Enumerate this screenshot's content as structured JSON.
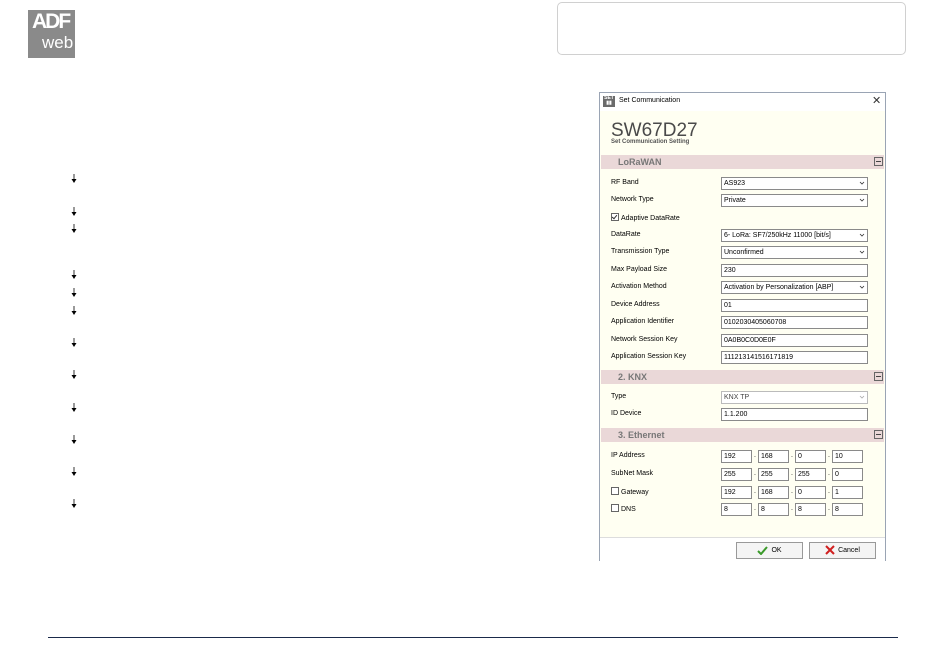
{
  "logo": {
    "line1": "ADF",
    "line2": "web"
  },
  "dialog": {
    "title": "Set Communication",
    "big_title": "SW67D27",
    "subtitle": "Set Communication Setting",
    "sections": {
      "lorawan": "LoRaWAN",
      "knx": "2. KNX",
      "ethernet": "3. Ethernet"
    },
    "lorawan": {
      "rf_band": {
        "label": "RF Band",
        "value": "AS923"
      },
      "network_type": {
        "label": "Network Type",
        "value": "Private"
      },
      "adaptive": {
        "label": "Adaptive DataRate",
        "checked": true
      },
      "datarate": {
        "label": "DataRate",
        "value": "6- LoRa: SF7/250kHz 11000 [bit/s]"
      },
      "transmission": {
        "label": "Transmission Type",
        "value": "Unconfirmed"
      },
      "max_payload": {
        "label": "Max Payload Size",
        "value": "230"
      },
      "activation": {
        "label": "Activation Method",
        "value": "Activation by Personalization [ABP]"
      },
      "device_address": {
        "label": "Device Address",
        "value": "01"
      },
      "app_id": {
        "label": "Application Identifier",
        "value": "0102030405060708"
      },
      "nwk_key": {
        "label": "Network Session Key",
        "value": "0A0B0C0D0E0F"
      },
      "app_key": {
        "label": "Application Session Key",
        "value": "111213141516171819"
      }
    },
    "knx": {
      "type": {
        "label": "Type",
        "value": "KNX TP"
      },
      "id_device": {
        "label": "ID Device",
        "value": "1.1.200"
      }
    },
    "ethernet": {
      "ip": {
        "label": "IP Address",
        "octets": [
          "192",
          "168",
          "0",
          "10"
        ]
      },
      "subnet": {
        "label": "SubNet Mask",
        "octets": [
          "255",
          "255",
          "255",
          "0"
        ]
      },
      "gateway": {
        "label": "Gateway",
        "checked": false,
        "octets": [
          "192",
          "168",
          "0",
          "1"
        ]
      },
      "dns": {
        "label": "DNS",
        "checked": false,
        "octets": [
          "8",
          "8",
          "8",
          "8"
        ]
      }
    },
    "buttons": {
      "ok": "OK",
      "cancel": "Cancel"
    }
  },
  "colors": {
    "section_bg": "#ead8d8",
    "panel_bg": "#fffff2",
    "ok_icon": "#3a9a2a",
    "cancel_icon": "#d02020"
  },
  "icons": [
    "down-arrow-bullet-icon",
    "close-icon",
    "chevron-down-icon",
    "collapse-icon",
    "check-icon",
    "cross-icon"
  ]
}
